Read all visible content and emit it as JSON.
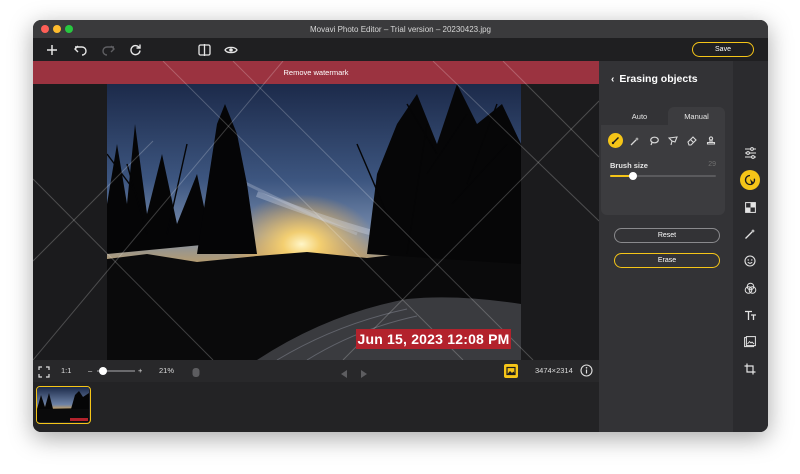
{
  "window": {
    "title": "Movavi Photo Editor – Trial version – 20230423.jpg"
  },
  "toolbar": {
    "save_label": "Save",
    "icons": [
      "add-icon",
      "undo-icon",
      "redo-icon",
      "rotate-icon",
      "compare-icon",
      "preview-eye-icon"
    ]
  },
  "canvas": {
    "banner_label": "Remove watermark",
    "date_stamp": "Jun 15, 2023 12:08 PM"
  },
  "bottombar": {
    "ratio_label": "1:1",
    "zoom_minus": "–",
    "zoom_plus": "+",
    "zoom_percent": "21%",
    "zoom_level": 0.15,
    "dimensions": "3474×2314"
  },
  "panel": {
    "title": "Erasing objects",
    "tabs": [
      {
        "label": "Auto",
        "active": false
      },
      {
        "label": "Manual",
        "active": true
      }
    ],
    "tools": [
      "brush-icon",
      "magic-wand-icon",
      "lasso-icon",
      "polygon-lasso-icon",
      "eraser-icon",
      "stamp-icon"
    ],
    "brush_size_label": "Brush size",
    "brush_size_value": "29",
    "brush_size_fraction": 0.22,
    "reset_label": "Reset",
    "erase_label": "Erase"
  },
  "rail": {
    "icons": [
      "adjust-sliders-icon",
      "object-removal-icon",
      "replace-background-icon",
      "magic-enhance-icon",
      "retouch-face-icon",
      "filters-icon",
      "text-icon",
      "insert-image-icon",
      "crop-icon"
    ]
  },
  "colors": {
    "accent": "#f5c518",
    "banner": "#9b3340",
    "stamp": "#b3222c",
    "panel_bg": "#333336",
    "app_bg": "#1b1b1d"
  }
}
